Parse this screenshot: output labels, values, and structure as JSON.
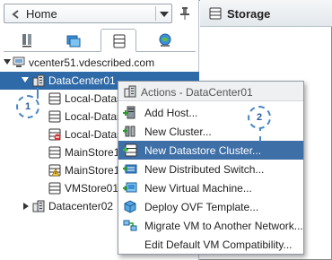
{
  "navigator": {
    "home_label": "Home",
    "tabs": [
      {
        "name": "hosts-and-clusters",
        "icon": "hosts-clusters-icon"
      },
      {
        "name": "vms-and-templates",
        "icon": "vms-templates-icon"
      },
      {
        "name": "storage",
        "icon": "storage-icon",
        "active": true
      },
      {
        "name": "networking",
        "icon": "networking-icon"
      }
    ],
    "tree": {
      "vcenter": "vcenter51.vdescribed.com",
      "datacenter": "DataCenter01",
      "datastores": [
        "Local-Datas",
        "Local-Datas",
        "Local-Datas",
        "MainStore1",
        "MainStore1",
        "VMStore01"
      ],
      "datacenter2": "Datacenter02"
    }
  },
  "pane": {
    "title": "Storage"
  },
  "callouts": [
    "1",
    "2"
  ],
  "context_menu": {
    "header": "Actions - DataCenter01",
    "items": [
      {
        "label": "Add Host...",
        "icon": "add-host-icon"
      },
      {
        "label": "New Cluster...",
        "icon": "new-cluster-icon"
      },
      {
        "label": "New Datastore Cluster...",
        "icon": "new-datastore-cluster-icon",
        "highlighted": true
      },
      {
        "label": "New Distributed Switch...",
        "icon": "new-distributed-switch-icon"
      },
      {
        "label": "New Virtual Machine...",
        "icon": "new-virtual-machine-icon"
      },
      {
        "label": "Deploy OVF Template...",
        "icon": "deploy-ovf-icon"
      },
      {
        "label": "Migrate VM to Another Network...",
        "icon": "migrate-vm-network-icon"
      },
      {
        "label": "Edit Default VM Compatibility...",
        "icon": ""
      }
    ]
  },
  "colors": {
    "selection": "#2f6aa8",
    "menu_highlight": "#3e6fa6",
    "callout": "#4a86c5"
  }
}
